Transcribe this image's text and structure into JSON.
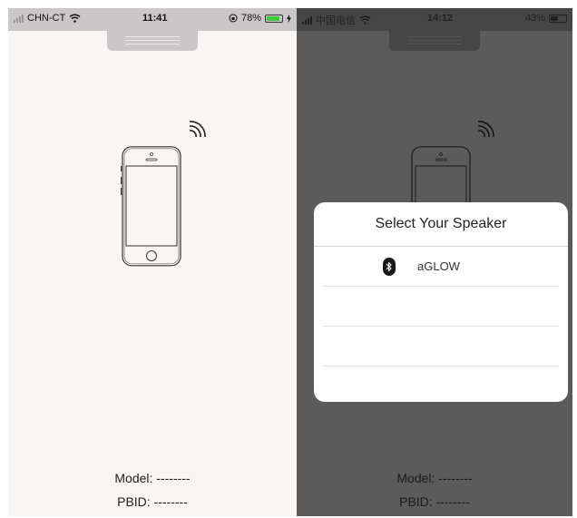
{
  "left_screen": {
    "status_bar": {
      "carrier": "CHN-CT",
      "time": "11:41",
      "battery_percent": "78%"
    },
    "model_label": "Model: --------",
    "pbid_label": "PBID: --------"
  },
  "right_screen": {
    "status_bar": {
      "carrier": "中国电信",
      "time": "14:12",
      "battery_percent": "43%"
    },
    "model_label": "Model: --------",
    "pbid_label": "PBID: --------"
  },
  "dialog": {
    "title": "Select Your Speaker",
    "speakers": [
      {
        "name": "aGLOW",
        "icon": "bluetooth-icon"
      }
    ]
  },
  "colors": {
    "left_background": "#f8f5f3",
    "dimmed_background": "#5b5b5b",
    "battery_green": "#3fca3a"
  }
}
